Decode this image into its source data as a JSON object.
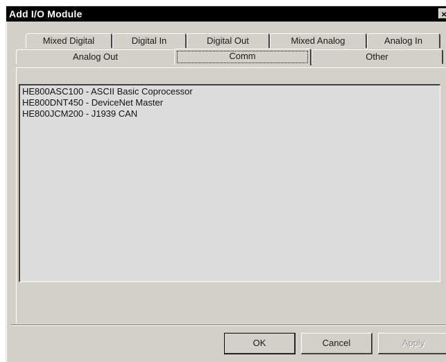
{
  "window": {
    "title": "Add I/O Module",
    "close_glyph": "×"
  },
  "tabs": {
    "row_back": [
      {
        "label": "Mixed Digital"
      },
      {
        "label": "Digital In"
      },
      {
        "label": "Digital Out"
      },
      {
        "label": "Mixed Analog"
      },
      {
        "label": "Analog In"
      }
    ],
    "row_front": [
      {
        "label": "Analog Out"
      },
      {
        "label": "Comm"
      },
      {
        "label": "Other"
      }
    ],
    "selected": "Comm"
  },
  "modules": {
    "items": [
      {
        "text": "HE800ASC100  -  ASCII Basic Coprocessor"
      },
      {
        "text": "HE800DNT450  -  DeviceNet Master"
      },
      {
        "text": "HE800JCM200  -  J1939 CAN"
      }
    ]
  },
  "buttons": {
    "ok_label": "OK",
    "cancel_label": "Cancel",
    "apply_label": "Apply"
  }
}
